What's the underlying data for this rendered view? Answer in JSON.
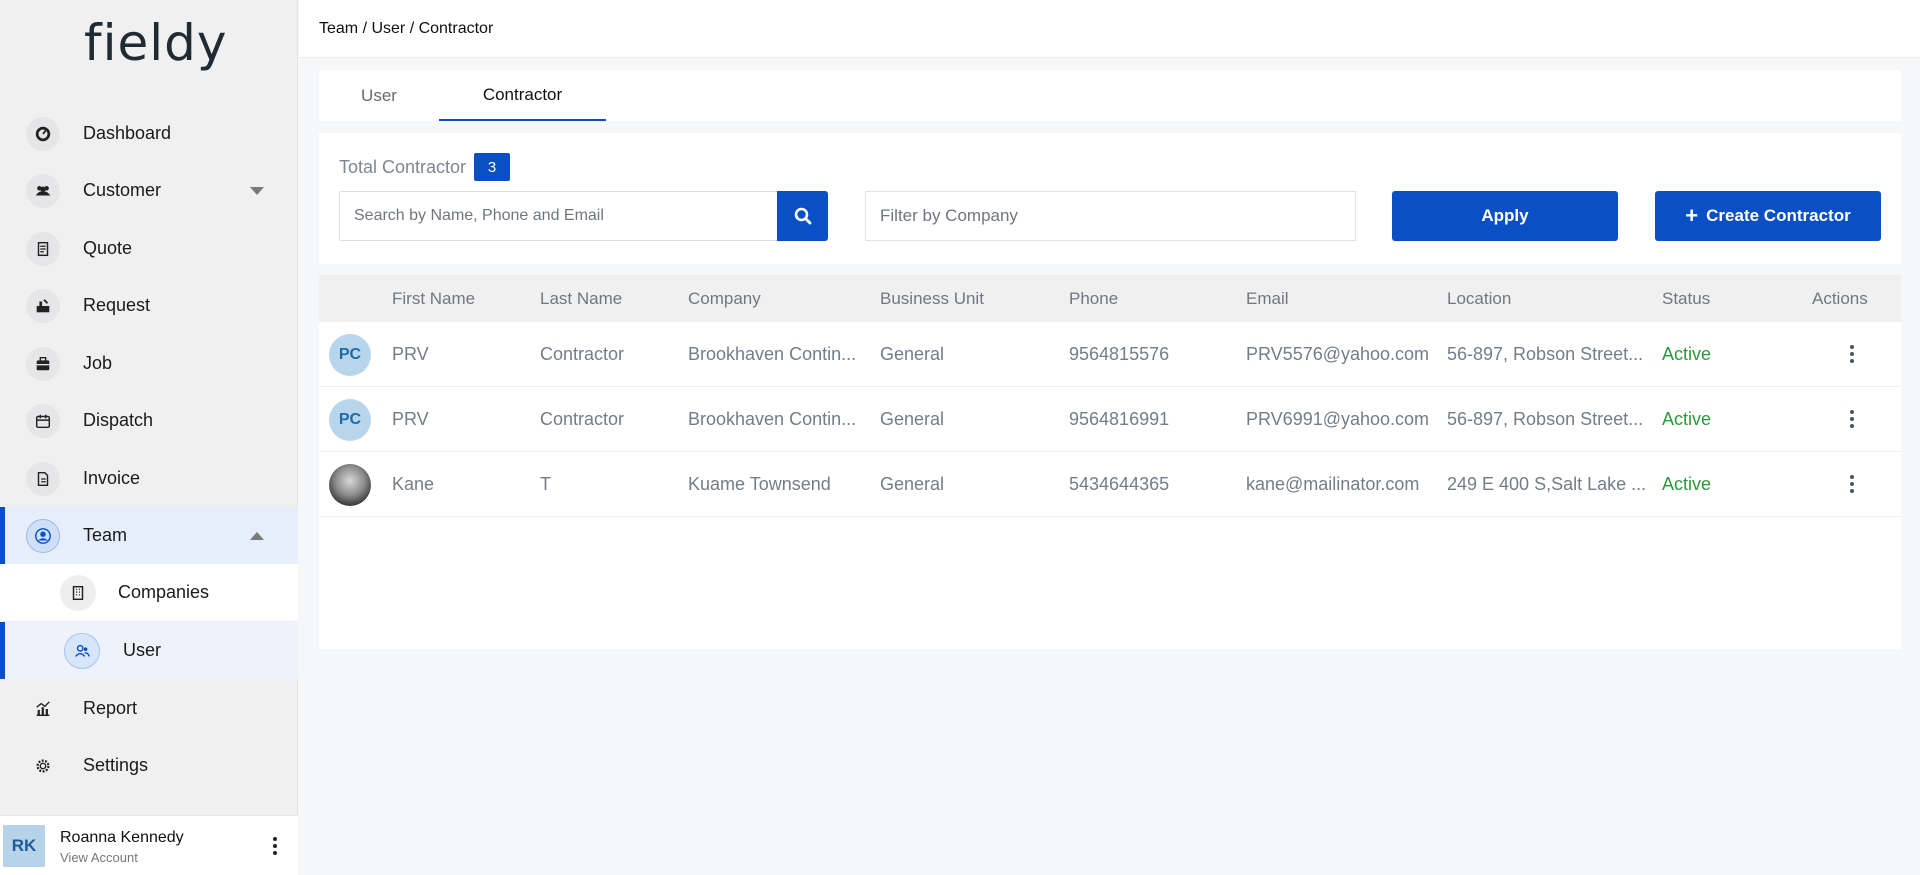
{
  "brand": {
    "logo_text": "fieldy"
  },
  "sidebar": {
    "items": [
      {
        "label": "Dashboard",
        "icon": "dashboard-icon"
      },
      {
        "label": "Customer",
        "icon": "customers-icon"
      },
      {
        "label": "Quote",
        "icon": "quote-icon"
      },
      {
        "label": "Request",
        "icon": "request-icon"
      },
      {
        "label": "Job",
        "icon": "job-icon"
      },
      {
        "label": "Dispatch",
        "icon": "dispatch-icon"
      },
      {
        "label": "Invoice",
        "icon": "invoice-icon"
      },
      {
        "label": "Team",
        "icon": "team-icon"
      },
      {
        "label": "Report",
        "icon": "report-icon"
      },
      {
        "label": "Settings",
        "icon": "settings-icon"
      }
    ],
    "team_sub": [
      {
        "label": "Companies",
        "icon": "building-icon"
      },
      {
        "label": "User",
        "icon": "users-icon"
      }
    ],
    "account": {
      "initials": "RK",
      "name": "Roanna Kennedy",
      "link": "View Account"
    }
  },
  "header": {
    "breadcrumb": "Team / User / Contractor"
  },
  "tabs": [
    {
      "label": "User"
    },
    {
      "label": "Contractor"
    }
  ],
  "filters": {
    "total_label": "Total Contractor",
    "total_count": "3",
    "search_placeholder": "Search by Name, Phone and Email",
    "company_placeholder": "Filter by Company",
    "apply_label": "Apply",
    "create_label": "Create Contractor"
  },
  "table": {
    "columns": [
      "First Name",
      "Last Name",
      "Company",
      "Business Unit",
      "Phone",
      "Email",
      "Location",
      "Status",
      "Actions"
    ],
    "rows": [
      {
        "avatar": "PC",
        "first": "PRV",
        "last": "Contractor",
        "company": "Brookhaven Contin...",
        "unit": "General",
        "phone": "9564815576",
        "email": "PRV5576@yahoo.com",
        "location": "56-897, Robson Street...",
        "status": "Active"
      },
      {
        "avatar": "PC",
        "first": "PRV",
        "last": "Contractor",
        "company": "Brookhaven Contin...",
        "unit": "General",
        "phone": "9564816991",
        "email": "PRV6991@yahoo.com",
        "location": "56-897, Robson Street...",
        "status": "Active"
      },
      {
        "avatar": "",
        "first": "Kane",
        "last": "T",
        "company": "Kuame Townsend",
        "unit": "General",
        "phone": "5434644365",
        "email": "kane@mailinator.com",
        "location": "249 E 400 S,Salt Lake ...",
        "status": "Active"
      }
    ]
  },
  "colors": {
    "primary": "#0b4fc4",
    "active_status": "#2b9b3a"
  }
}
